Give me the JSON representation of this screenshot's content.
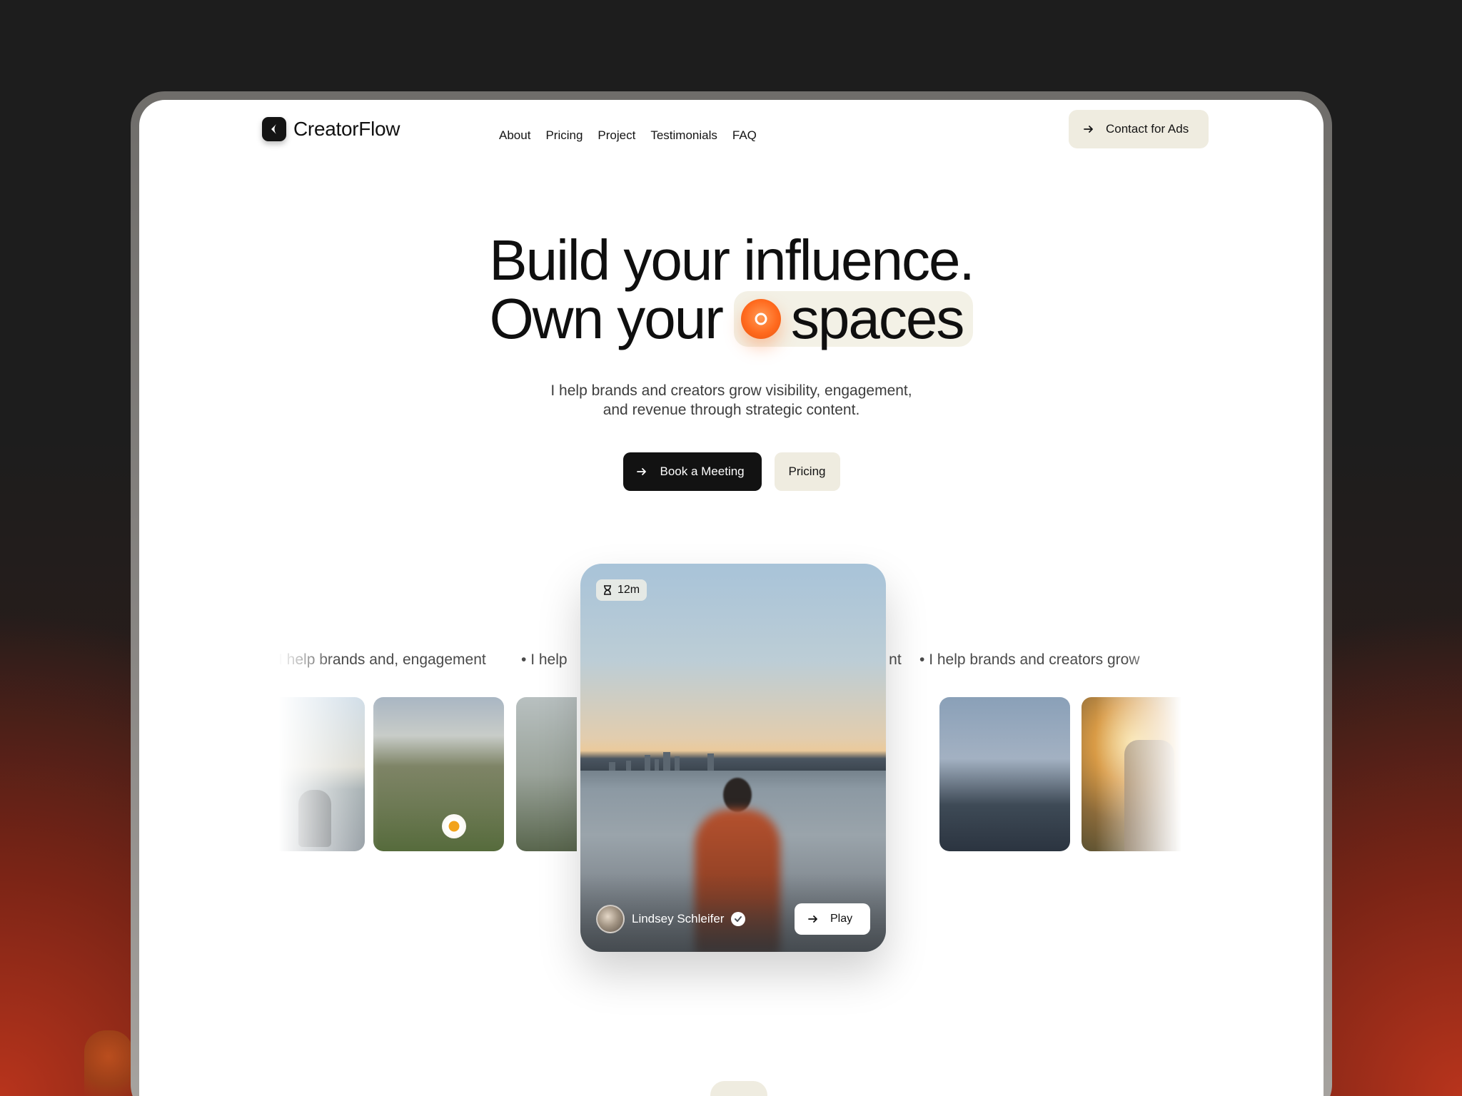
{
  "brand": {
    "name": "CreatorFlow"
  },
  "nav": {
    "links": [
      "About",
      "Pricing",
      "Project",
      "Testimonials",
      "FAQ"
    ],
    "contact_label": "Contact for Ads"
  },
  "hero": {
    "line1": "Build your influence.",
    "line2_prefix": "Own your",
    "line2_highlight": "spaces",
    "subtitle_line1": "I help brands and creators grow visibility, engagement,",
    "subtitle_line2": "and revenue through strategic content.",
    "primary_cta": "Book a Meeting",
    "secondary_cta": "Pricing"
  },
  "marquee": {
    "items": [
      "I help brands and, engagement",
      "I help",
      "ment",
      "I help brands and creators grow"
    ]
  },
  "featured_card": {
    "duration": "12m",
    "author": "Lindsey Schleifer",
    "play_label": "Play"
  },
  "colors": {
    "accent_orange": "#ff6a1e",
    "pill_beige": "#efece0",
    "dark": "#121212"
  },
  "icons": [
    "arrow-right-icon",
    "hourglass-icon",
    "verified-check-icon",
    "logo-mark-icon"
  ]
}
